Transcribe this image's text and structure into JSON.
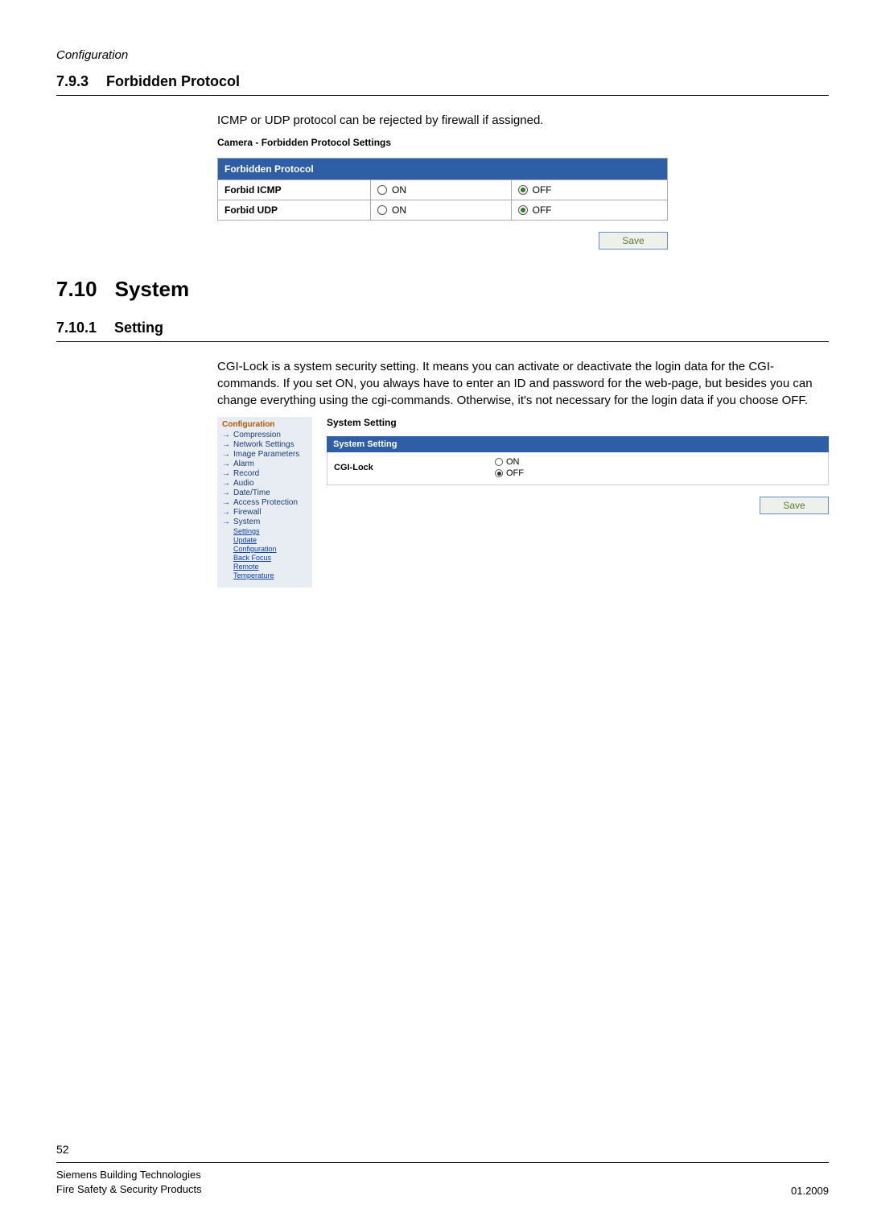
{
  "page": {
    "header": "Configuration",
    "number": "52"
  },
  "s793": {
    "num": "7.9.3",
    "title": "Forbidden Protocol",
    "body": "ICMP or UDP protocol can be rejected by firewall if assigned.",
    "panel_title": "Camera - Forbidden Protocol Settings",
    "table_header": "Forbidden Protocol",
    "rows": [
      {
        "label": "Forbid ICMP",
        "on": "ON",
        "off": "OFF",
        "selected": "off"
      },
      {
        "label": "Forbid UDP",
        "on": "ON",
        "off": "OFF",
        "selected": "off"
      }
    ],
    "save": "Save"
  },
  "s710": {
    "num": "7.10",
    "title": "System"
  },
  "s7101": {
    "num": "7.10.1",
    "title": "Setting",
    "body": "CGI-Lock is a system security setting. It means you can activate or deactivate the login data for the CGI-commands. If you set ON, you always have to enter an ID and password for the web-page, but besides you can change everything using the cgi-commands. Otherwise, it's not necessary for the login data if you choose OFF.",
    "sidebar": {
      "title": "Configuration",
      "items": [
        "Compression",
        "Network Settings",
        "Image Parameters",
        "Alarm",
        "Record",
        "Audio",
        "Date/Time",
        "Access Protection",
        "Firewall",
        "System"
      ],
      "sub": [
        "Settings",
        "Update",
        "Configuration",
        "Back Focus",
        "Remote",
        "Temperature"
      ]
    },
    "main": {
      "title": "System Setting",
      "table_header": "System Setting",
      "row_label": "CGI-Lock",
      "on": "ON",
      "off": "OFF",
      "selected": "off",
      "save": "Save"
    }
  },
  "footer": {
    "line1": "Siemens Building Technologies",
    "line2": "Fire Safety & Security Products",
    "date": "01.2009"
  }
}
